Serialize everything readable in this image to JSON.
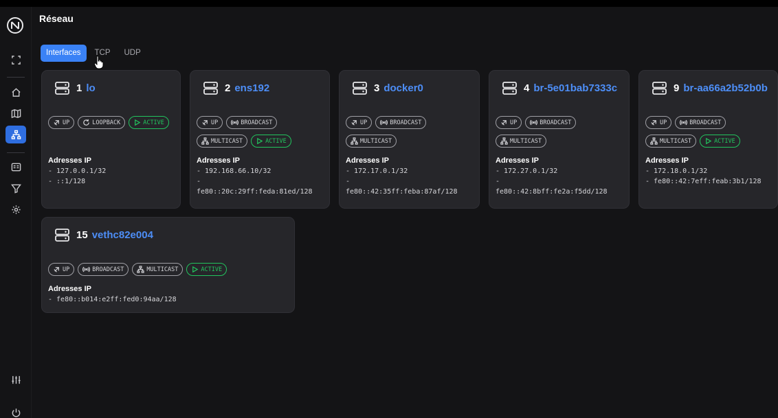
{
  "page": {
    "title": "Réseau"
  },
  "tabs": [
    {
      "label": "Interfaces",
      "active": true
    },
    {
      "label": "TCP",
      "active": false
    },
    {
      "label": "UDP",
      "active": false
    }
  ],
  "sidebar": [
    {
      "icon": "fullscreen-icon"
    },
    {
      "icon": "home-icon"
    },
    {
      "icon": "map-icon"
    },
    {
      "icon": "network-icon",
      "active": true
    },
    {
      "icon": "terminal-icon"
    },
    {
      "icon": "filter-icon"
    },
    {
      "icon": "settings-icon"
    },
    {
      "icon": "sliders-icon"
    },
    {
      "icon": "power-icon"
    }
  ],
  "ip_section_label": "Adresses IP",
  "interfaces": [
    {
      "num": "1",
      "name": "lo",
      "flags": [
        {
          "label": "UP",
          "icon": "up-icon"
        },
        {
          "label": "LOOPBACK",
          "icon": "loopback-icon"
        },
        {
          "label": "ACTIVE",
          "icon": "play-icon",
          "green": true
        }
      ],
      "ips": [
        "- 127.0.0.1/32",
        "- ::1/128"
      ]
    },
    {
      "num": "2",
      "name": "ens192",
      "flags": [
        {
          "label": "UP",
          "icon": "up-icon"
        },
        {
          "label": "BROADCAST",
          "icon": "broadcast-icon"
        },
        {
          "label": "MULTICAST",
          "icon": "multicast-icon"
        },
        {
          "label": "ACTIVE",
          "icon": "play-icon",
          "green": true
        }
      ],
      "ips": [
        "- 192.168.66.10/32",
        "-",
        "fe80::20c:29ff:feda:81ed/128"
      ]
    },
    {
      "num": "3",
      "name": "docker0",
      "flags": [
        {
          "label": "UP",
          "icon": "up-icon"
        },
        {
          "label": "BROADCAST",
          "icon": "broadcast-icon"
        },
        {
          "label": "MULTICAST",
          "icon": "multicast-icon"
        }
      ],
      "ips": [
        "- 172.17.0.1/32",
        "-",
        "fe80::42:35ff:feba:87af/128"
      ]
    },
    {
      "num": "4",
      "name": "br-5e01bab7333c",
      "flags": [
        {
          "label": "UP",
          "icon": "up-icon"
        },
        {
          "label": "BROADCAST",
          "icon": "broadcast-icon"
        },
        {
          "label": "MULTICAST",
          "icon": "multicast-icon"
        }
      ],
      "ips": [
        "- 172.27.0.1/32",
        "-",
        "fe80::42:8bff:fe2a:f5dd/128"
      ]
    },
    {
      "num": "9",
      "name": "br-aa66a2b52b0b",
      "flags": [
        {
          "label": "UP",
          "icon": "up-icon"
        },
        {
          "label": "BROADCAST",
          "icon": "broadcast-icon"
        },
        {
          "label": "MULTICAST",
          "icon": "multicast-icon"
        },
        {
          "label": "ACTIVE",
          "icon": "play-icon",
          "green": true
        }
      ],
      "ips": [
        "- 172.18.0.1/32",
        "- fe80::42:7eff:feab:3b1/128"
      ]
    },
    {
      "num": "15",
      "name": "vethc82e004",
      "flags": [
        {
          "label": "UP",
          "icon": "up-icon"
        },
        {
          "label": "BROADCAST",
          "icon": "broadcast-icon"
        },
        {
          "label": "MULTICAST",
          "icon": "multicast-icon"
        },
        {
          "label": "ACTIVE",
          "icon": "play-icon",
          "green": true
        }
      ],
      "ips": [
        "- fe80::b014:e2ff:fed0:94aa/128"
      ]
    }
  ],
  "colors": {
    "accent": "#3a82f6",
    "link": "#4d8ef7",
    "active": "#22c55e",
    "card": "#26262a",
    "background": "#141416"
  }
}
